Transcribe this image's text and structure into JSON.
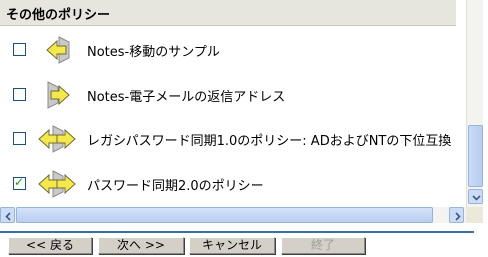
{
  "section": {
    "title": "その他のポリシー"
  },
  "policies": [
    {
      "label": "Notes-移動のサンプル",
      "checked": false,
      "icon": "policy-arrow-left-icon"
    },
    {
      "label": "Notes-電子メールの返信アドレス",
      "checked": false,
      "icon": "policy-arrow-right-icon"
    },
    {
      "label": "レガシパスワード同期1.0のポリシー: ADおよびNTの下位互換",
      "checked": false,
      "icon": "policy-arrow-both-icon"
    },
    {
      "label": "パスワード同期2.0のポリシー",
      "checked": true,
      "icon": "policy-arrow-both-icon"
    }
  ],
  "buttons": {
    "back": "<< 戻る",
    "next": "次へ >>",
    "cancel": "キャンセル",
    "finish": "終了"
  },
  "colors": {
    "header_bg": "#e7e6de",
    "scroll_blue": "#b8cdf0",
    "divider": "#3a6ea5",
    "icon_yellow": "#f5e84a",
    "icon_gray": "#9a9a9a"
  }
}
